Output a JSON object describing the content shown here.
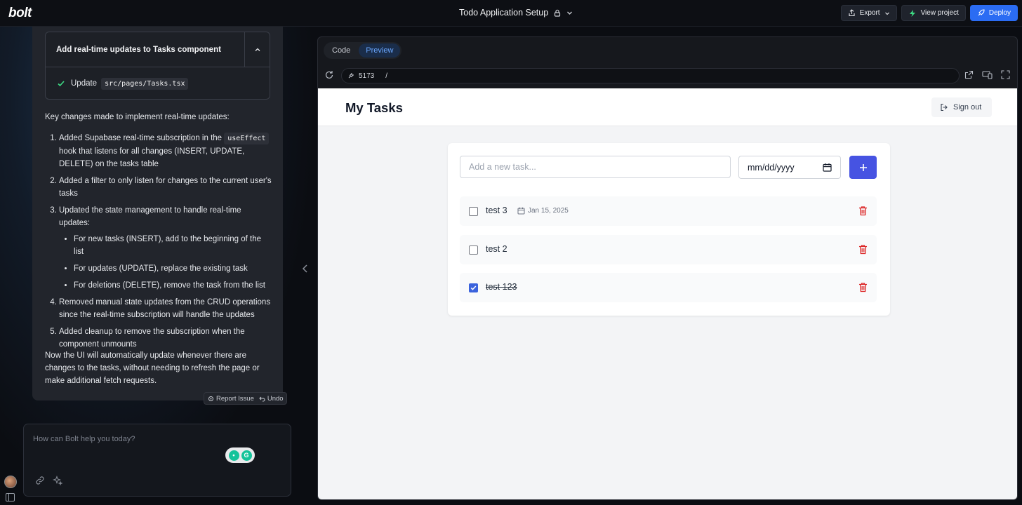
{
  "topbar": {
    "logo": "bolt",
    "project_title": "Todo Application Setup",
    "export_label": "Export",
    "view_project_label": "View project",
    "deploy_label": "Deploy"
  },
  "chat": {
    "action": {
      "title": "Add real-time updates to Tasks component",
      "update_verb": "Update",
      "file_path": "src/pages/Tasks.tsx"
    },
    "intro": "Key changes made to implement real-time updates:",
    "step1_a": "Added Supabase real-time subscription in the",
    "step1_code": "useEffect",
    "step1_b": "hook that listens for all changes (INSERT, UPDATE, DELETE) on the tasks table",
    "step2": "Added a filter to only listen for changes to the current user's tasks",
    "step3": "Updated the state management to handle real-time updates:",
    "step3_sub": [
      "For new tasks (INSERT), add to the beginning of the list",
      "For updates (UPDATE), replace the existing task",
      "For deletions (DELETE), remove the task from the list"
    ],
    "step4": "Removed manual state updates from the CRUD operations since the real-time subscription will handle the updates",
    "step5": "Added cleanup to remove the subscription when the component unmounts",
    "outro": "Now the UI will automatically update whenever there are changes to the tasks, without needing to refresh the page or make additional fetch requests.",
    "report_issue_label": "Report Issue",
    "undo_label": "Undo",
    "prompt_placeholder": "How can Bolt help you today?"
  },
  "workbench": {
    "tab_code": "Code",
    "tab_preview": "Preview",
    "port": "5173",
    "path": "/"
  },
  "app": {
    "title": "My Tasks",
    "sign_out_label": "Sign out",
    "new_task_placeholder": "Add a new task...",
    "date_placeholder": "mm/dd/yyyy",
    "tasks": [
      {
        "label": "test 3",
        "due": "Jan 15, 2025",
        "done": false
      },
      {
        "label": "test 2",
        "due": "",
        "done": false
      },
      {
        "label": "test 123",
        "due": "",
        "done": true
      }
    ]
  },
  "colors": {
    "accent_blue": "#2b6cf3",
    "add_button": "#4653e2",
    "delete_red": "#dc2626"
  }
}
